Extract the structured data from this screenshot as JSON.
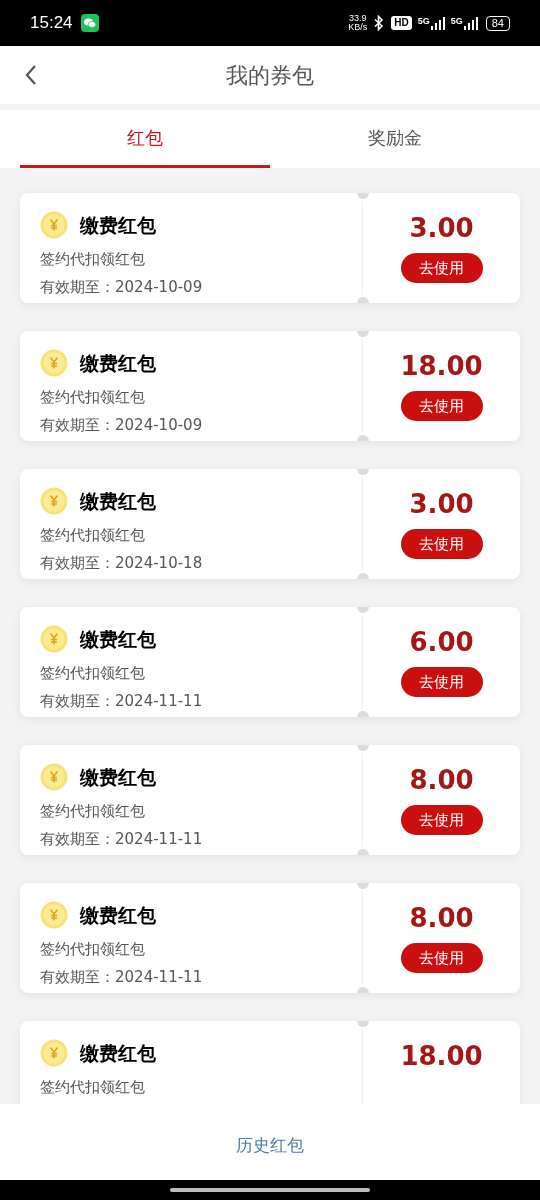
{
  "status_bar": {
    "time": "15:24",
    "speed_value": "33.9",
    "speed_unit": "KB/s",
    "hd": "HD",
    "network_1": "5G",
    "network_2": "5G",
    "battery": "84"
  },
  "header": {
    "title": "我的券包"
  },
  "tabs": [
    {
      "label": "红包",
      "selected": true
    },
    {
      "label": "奖励金",
      "selected": false
    }
  ],
  "cards": [
    {
      "title": "缴费红包",
      "subtitle": "签约代扣领红包",
      "expiry": "有效期至：2024-10-09",
      "amount": "3.00",
      "button": "去使用"
    },
    {
      "title": "缴费红包",
      "subtitle": "签约代扣领红包",
      "expiry": "有效期至：2024-10-09",
      "amount": "18.00",
      "button": "去使用"
    },
    {
      "title": "缴费红包",
      "subtitle": "签约代扣领红包",
      "expiry": "有效期至：2024-10-18",
      "amount": "3.00",
      "button": "去使用"
    },
    {
      "title": "缴费红包",
      "subtitle": "签约代扣领红包",
      "expiry": "有效期至：2024-11-11",
      "amount": "6.00",
      "button": "去使用"
    },
    {
      "title": "缴费红包",
      "subtitle": "签约代扣领红包",
      "expiry": "有效期至：2024-11-11",
      "amount": "8.00",
      "button": "去使用"
    },
    {
      "title": "缴费红包",
      "subtitle": "签约代扣领红包",
      "expiry": "有效期至：2024-11-11",
      "amount": "8.00",
      "button": "去使用"
    },
    {
      "title": "缴费红包",
      "subtitle": "签约代扣领红包",
      "amount": "18.00"
    }
  ],
  "footer": {
    "link": "历史红包"
  }
}
